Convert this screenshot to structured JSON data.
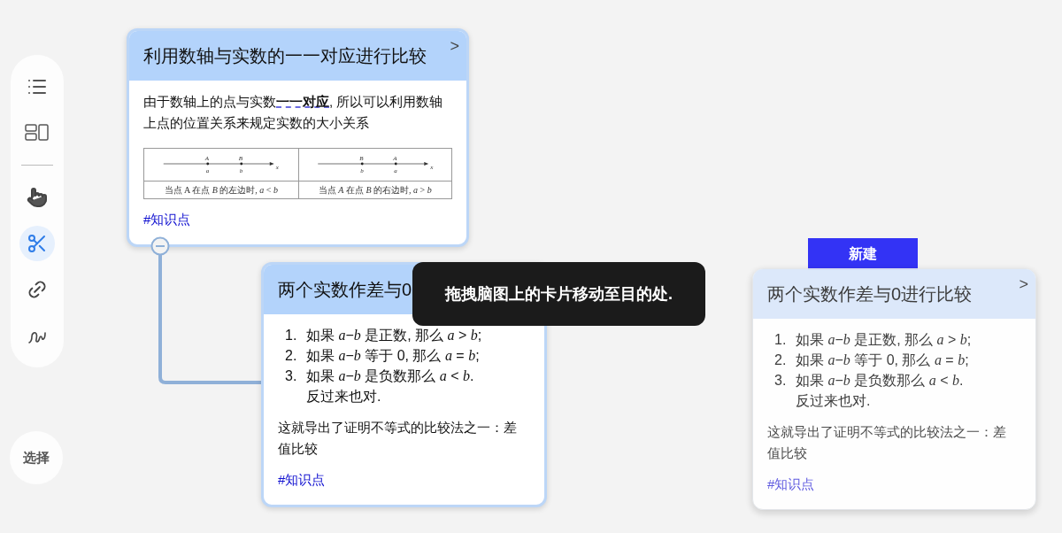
{
  "toolbar": {
    "tools": [
      {
        "kind": "list",
        "selected": false
      },
      {
        "kind": "layout",
        "selected": false
      },
      {
        "kind": "hand",
        "selected": false
      },
      {
        "kind": "scissors",
        "selected": true
      },
      {
        "kind": "link",
        "selected": false
      },
      {
        "kind": "pen",
        "selected": false
      }
    ]
  },
  "select_button": "选择",
  "cards": [
    {
      "title": "利用数轴与实数的一一对应进行比较",
      "selected": true,
      "chevron": ">",
      "paragraph": "由于数轴上的点与实数**一一对应**, 所以可以利用数轴上点的位置关系来规定实数的大小关系",
      "figure": [
        {
          "points": [
            {
              "upper": "A",
              "lower": "a"
            },
            {
              "upper": "B",
              "lower": "b"
            }
          ],
          "axis": "x",
          "caption": "当点 A 在点 *B* 的左边时, *a* < *b*"
        },
        {
          "points": [
            {
              "upper": "B",
              "lower": "b"
            },
            {
              "upper": "A",
              "lower": "a"
            }
          ],
          "axis": "x",
          "caption": "当点 *A* 在点 *B* 的右边时, *a* > *b*"
        }
      ],
      "tag": "#知识点"
    },
    {
      "title": "两个实数作差与0",
      "selected": true,
      "list": [
        {
          "number": "1.",
          "text": "如果 *a*−*b* 是正数, 那么 *a* > *b*;"
        },
        {
          "number": "2.",
          "text": "如果 *a*−*b* 等于 0, 那么 *a* = *b*;"
        },
        {
          "number": "3.",
          "text": "如果 *a*−*b* 是负数那么 *a* < *b*."
        }
      ],
      "list_note": "反过来也对.",
      "paragraph": "这就导出了证明不等式的比较法之一：差值比较",
      "tag": "#知识点"
    },
    {
      "title": "两个实数作差与0进行比较",
      "selected": false,
      "chevron": ">",
      "list": [
        {
          "number": "1.",
          "text": "如果 *a*−*b* 是正数, 那么 *a* > *b*;"
        },
        {
          "number": "2.",
          "text": "如果 *a*−*b* 等于 0, 那么 *a* = *b*;"
        },
        {
          "number": "3.",
          "text": "如果 *a*−*b* 是负数那么 *a* < *b*."
        }
      ],
      "list_note": "反过来也对.",
      "paragraph": "这就导出了证明不等式的比较法之一：差值比较",
      "tag": "#知识点"
    }
  ],
  "new_button": "新建",
  "tooltip": "拖拽脑图上的卡片移动至目的处."
}
